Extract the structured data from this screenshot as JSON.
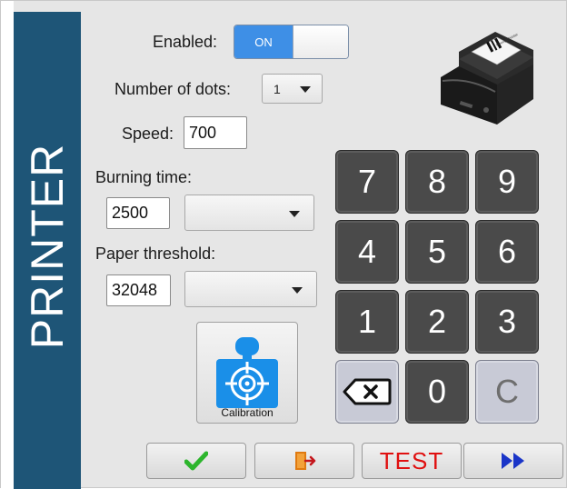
{
  "side_panel": {
    "title": "PRINTER"
  },
  "enabled": {
    "label": "Enabled:",
    "toggle_state": "ON"
  },
  "dots": {
    "label": "Number of dots:",
    "value": "1"
  },
  "speed": {
    "label": "Speed:",
    "value": "700"
  },
  "burning": {
    "label": "Burning time:",
    "value": "2500",
    "dropdown_value": ""
  },
  "paper": {
    "label": "Paper threshold:",
    "value": "32048",
    "dropdown_value": ""
  },
  "calibration": {
    "label": "Calibration",
    "icon": "target-calibration-icon"
  },
  "printer_image": {
    "label_text": "Receipt Printer"
  },
  "keypad": {
    "keys": [
      "7",
      "8",
      "9",
      "4",
      "5",
      "6",
      "1",
      "2",
      "3",
      "",
      "0",
      "C"
    ],
    "backspace_icon": "backspace-icon"
  },
  "bottom_bar": {
    "confirm_icon": "checkmark-icon",
    "exit_icon": "exit-door-icon",
    "test_label": "TEST",
    "forward_icon": "fast-forward-icon"
  },
  "colors": {
    "side_panel": "#1e5577",
    "toggle_on": "#3e8fe6",
    "key_dark": "#4a4a4a",
    "key_light": "#c8cad6",
    "test_red": "#e01010",
    "check_green": "#2db52d",
    "exit_orange": "#e07a10",
    "forward_blue": "#1a35c8",
    "calibration_blue": "#1a8fe8"
  }
}
